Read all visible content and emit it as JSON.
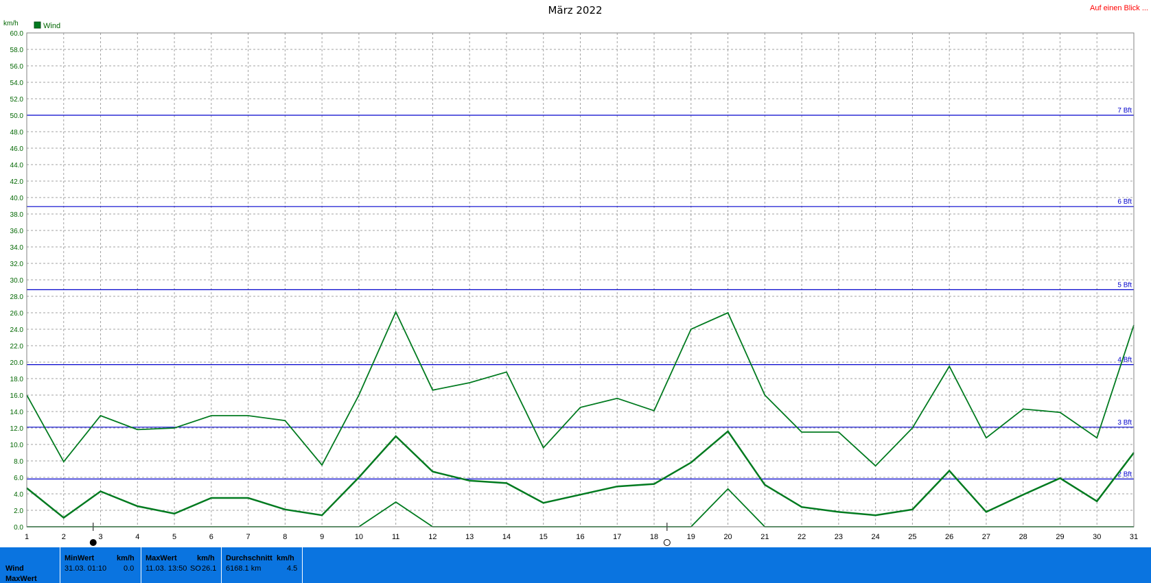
{
  "header": {
    "link_label": "Auf einen Blick ..."
  },
  "chart_data": {
    "type": "line",
    "title": "März 2022",
    "ylabel": "km/h",
    "xlabel": "",
    "legend": [
      "Wind"
    ],
    "legend_placement": "top-left",
    "grid": true,
    "xlim": [
      1,
      31
    ],
    "ylim": [
      0,
      60
    ],
    "x": [
      1,
      2,
      3,
      4,
      5,
      6,
      7,
      8,
      9,
      10,
      11,
      12,
      13,
      14,
      15,
      16,
      17,
      18,
      19,
      20,
      21,
      22,
      23,
      24,
      25,
      26,
      27,
      28,
      29,
      30,
      31
    ],
    "xtick_labels": [
      "1",
      "2",
      "3",
      "4",
      "5",
      "6",
      "7",
      "8",
      "9",
      "10",
      "11",
      "12",
      "13",
      "14",
      "15",
      "16",
      "17",
      "18",
      "19",
      "20",
      "21",
      "22",
      "23",
      "24",
      "25",
      "26",
      "27",
      "28",
      "29",
      "30",
      "31"
    ],
    "ytick_labels": [
      "0.0",
      "2.0",
      "4.0",
      "6.0",
      "8.0",
      "10.0",
      "12.0",
      "14.0",
      "16.0",
      "18.0",
      "20.0",
      "22.0",
      "24.0",
      "26.0",
      "28.0",
      "30.0",
      "32.0",
      "34.0",
      "36.0",
      "38.0",
      "40.0",
      "42.0",
      "44.0",
      "46.0",
      "48.0",
      "50.0",
      "52.0",
      "54.0",
      "56.0",
      "58.0",
      "60.0"
    ],
    "series": [
      {
        "name": "Wind",
        "role": "max",
        "color": "#007a1f",
        "values": [
          16.0,
          7.9,
          13.5,
          11.8,
          12.0,
          13.5,
          13.5,
          12.9,
          7.5,
          16.0,
          26.1,
          16.6,
          17.5,
          18.8,
          9.6,
          14.5,
          15.6,
          14.1,
          24.0,
          26.0,
          16.0,
          11.5,
          11.5,
          7.4,
          12.0,
          19.5,
          10.8,
          14.3,
          13.9,
          10.8,
          24.5
        ]
      },
      {
        "name": "Wind",
        "role": "average",
        "color": "#007a1f",
        "values": [
          4.7,
          1.1,
          4.3,
          2.5,
          1.6,
          3.5,
          3.5,
          2.1,
          1.4,
          6.0,
          11.0,
          6.7,
          5.6,
          5.3,
          2.9,
          3.9,
          4.9,
          5.2,
          7.8,
          11.6,
          5.1,
          2.4,
          1.8,
          1.4,
          2.1,
          6.8,
          1.8,
          3.9,
          5.9,
          3.1,
          9.0
        ]
      },
      {
        "name": "Wind",
        "role": "min",
        "color": "#007a1f",
        "values": [
          0,
          0,
          0,
          0,
          0,
          0,
          0,
          0,
          0,
          0,
          3.0,
          0,
          0,
          0,
          0,
          0,
          0,
          0,
          0,
          4.6,
          0,
          0,
          0,
          0,
          0,
          0,
          0,
          0,
          0,
          0,
          0
        ]
      }
    ],
    "reference_lines": [
      {
        "label": "2 Bft",
        "value": 5.8
      },
      {
        "label": "3 Bft",
        "value": 12.1
      },
      {
        "label": "4 Bft",
        "value": 19.7
      },
      {
        "label": "5 Bft",
        "value": 28.8
      },
      {
        "label": "6 Bft",
        "value": 38.9
      },
      {
        "label": "7 Bft",
        "value": 50.0
      }
    ],
    "colors": {
      "series": "#007a1f",
      "reference": "#0000cc",
      "grid": "#a0a0a0"
    },
    "moon_markers": [
      {
        "x": 2.8,
        "phase": "new-moon"
      },
      {
        "x": 18.35,
        "phase": "full-moon"
      }
    ]
  },
  "footer": {
    "row1_label": "Wind",
    "row2_label": "MaxWert",
    "min": {
      "header": "MinWert",
      "unit": "km/h",
      "time": "31.03.  01:10",
      "value": "0.0"
    },
    "max": {
      "header": "MaxWert",
      "unit": "km/h",
      "time": "11.03.  13:50",
      "dir": "SO",
      "value": "26.1"
    },
    "avg": {
      "header": "Durchschnitt",
      "unit": "km/h",
      "distance": "6168.1 km",
      "value": "4.5"
    },
    "colors": {
      "background": "#0a74e0"
    }
  }
}
